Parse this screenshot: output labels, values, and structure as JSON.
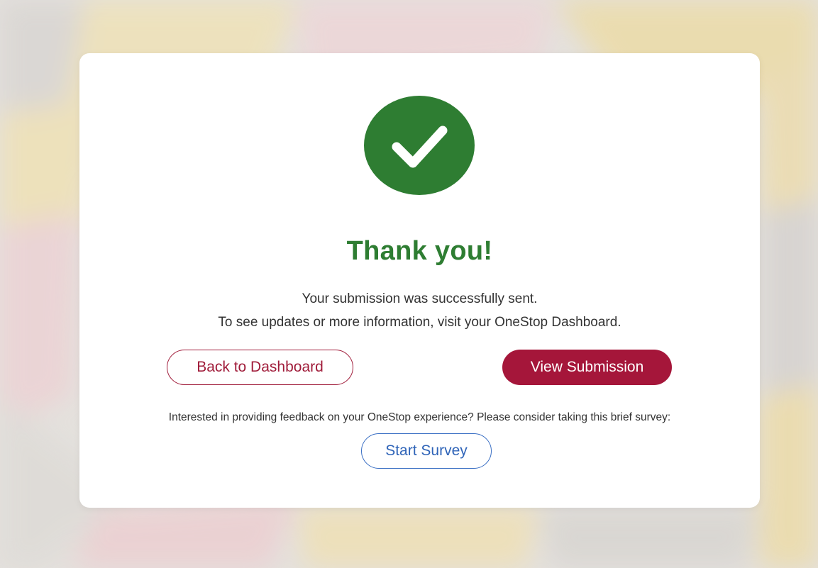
{
  "colors": {
    "success_green": "#2e7d32",
    "brand_red": "#a5163a",
    "survey_blue": "#3a6fc4",
    "card_bg": "#ffffff"
  },
  "confirmation": {
    "icon": "checkmark-icon",
    "title": "Thank you!",
    "message_line1": "Your submission was successfully sent.",
    "message_line2": "To see updates or more information, visit your OneStop Dashboard."
  },
  "actions": {
    "back_label": "Back to Dashboard",
    "view_label": "View Submission"
  },
  "survey": {
    "prompt": "Interested in providing feedback on your OneStop experience? Please consider taking this brief survey:",
    "button_label": "Start Survey"
  }
}
